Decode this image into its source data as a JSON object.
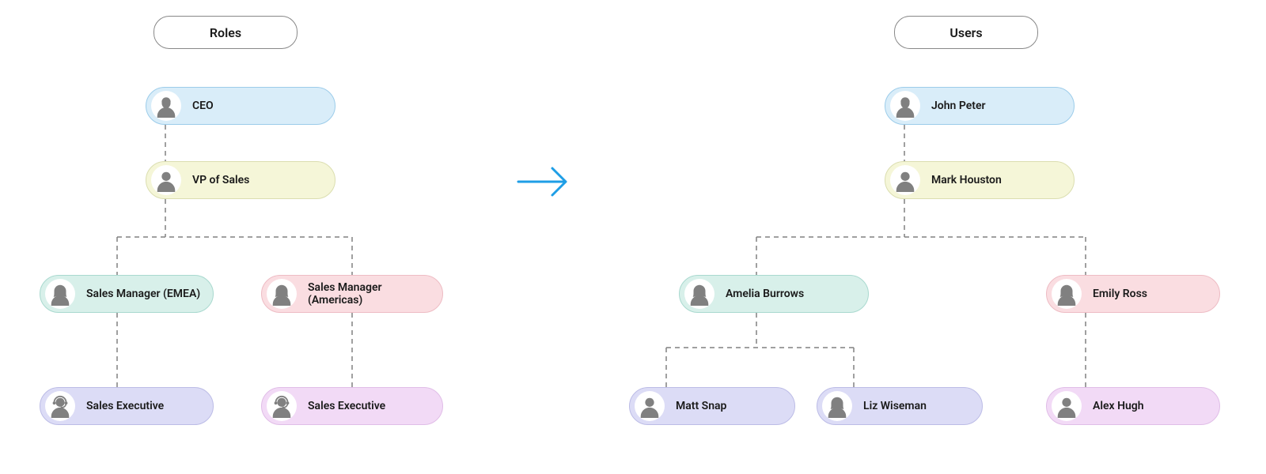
{
  "headers": {
    "roles": "Roles",
    "users": "Users"
  },
  "roles": {
    "ceo": {
      "label": "CEO",
      "avatar": "man-beard"
    },
    "vp": {
      "label": "VP of Sales",
      "avatar": "man"
    },
    "mgr_emea": {
      "label": "Sales Manager (EMEA)",
      "avatar": "woman"
    },
    "mgr_amer": {
      "label": "Sales Manager (Americas)",
      "avatar": "woman"
    },
    "exec_1": {
      "label": "Sales Executive",
      "avatar": "man-headset"
    },
    "exec_2": {
      "label": "Sales Executive",
      "avatar": "man-headset"
    }
  },
  "users": {
    "john": {
      "label": "John Peter",
      "avatar": "man-beard"
    },
    "mark": {
      "label": "Mark Houston",
      "avatar": "man"
    },
    "amelia": {
      "label": "Amelia Burrows",
      "avatar": "woman"
    },
    "emily": {
      "label": "Emily Ross",
      "avatar": "woman"
    },
    "matt": {
      "label": "Matt Snap",
      "avatar": "man"
    },
    "liz": {
      "label": "Liz Wiseman",
      "avatar": "woman"
    },
    "alex": {
      "label": "Alex Hugh",
      "avatar": "man"
    }
  },
  "colors": {
    "blue": "#d9edf9",
    "yellow": "#f5f6d8",
    "teal": "#d8f0ea",
    "rose": "#fadde1",
    "indigo": "#dcdcf6",
    "magenta": "#f2daf6",
    "arrow": "#1e9ee6"
  }
}
